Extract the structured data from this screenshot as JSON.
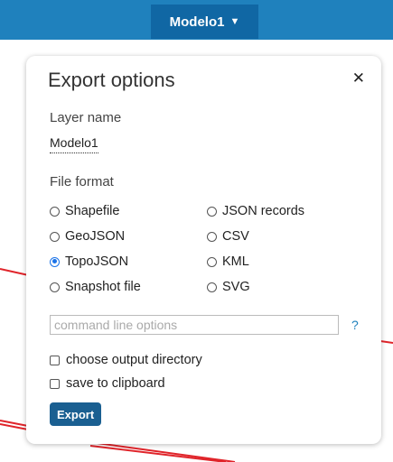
{
  "header": {
    "layer_selector_label": "Modelo1",
    "caret": "▼"
  },
  "panel": {
    "title": "Export options",
    "close_glyph": "✕",
    "layer_name_label": "Layer name",
    "layer_name_value": "Modelo1",
    "file_format_label": "File format",
    "formats": [
      {
        "label": "Shapefile",
        "checked": false
      },
      {
        "label": "JSON records",
        "checked": false
      },
      {
        "label": "GeoJSON",
        "checked": false
      },
      {
        "label": "CSV",
        "checked": false
      },
      {
        "label": "TopoJSON",
        "checked": true
      },
      {
        "label": "KML",
        "checked": false
      },
      {
        "label": "Snapshot file",
        "checked": false
      },
      {
        "label": "SVG",
        "checked": false
      }
    ],
    "command_line_placeholder": "command line options",
    "command_line_value": "",
    "help_label": "?",
    "choose_output_directory_label": "choose output directory",
    "save_to_clipboard_label": "save to clipboard",
    "export_button_label": "Export"
  },
  "colors": {
    "topbar": "#1f81bd",
    "layer_selector": "#1067a4",
    "selected_radio": "#1a73e8",
    "export_button": "#1a5f91",
    "map_lines": "#e0242a"
  }
}
